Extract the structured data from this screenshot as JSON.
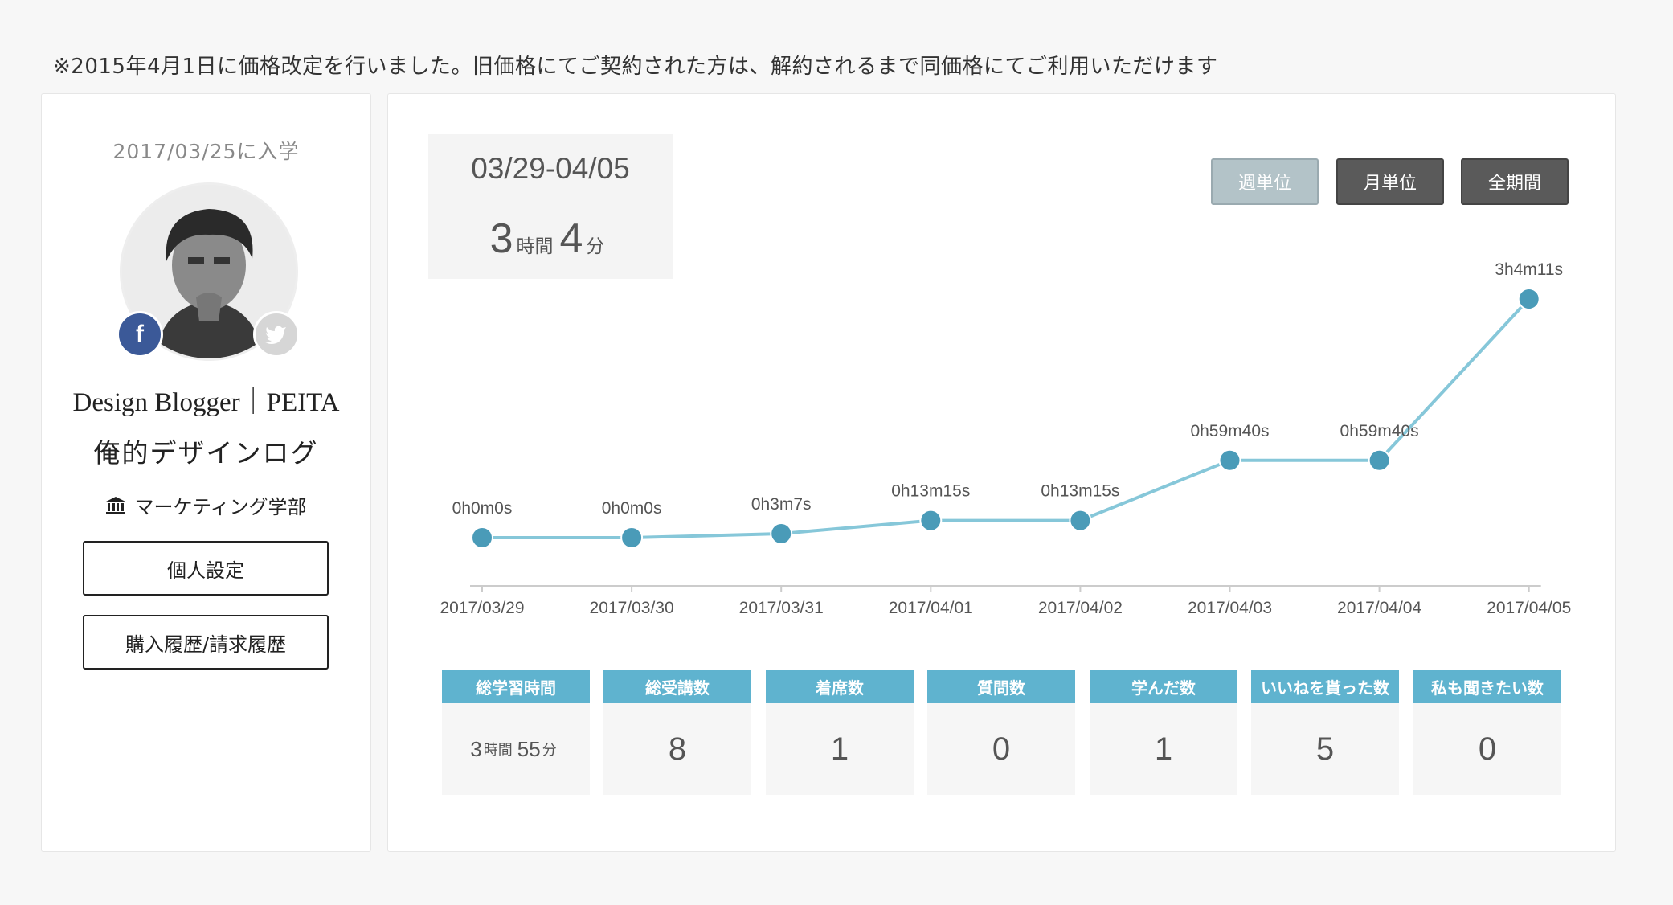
{
  "notice": "※2015年4月1日に価格改定を行いました。旧価格にてご契約された方は、解約されるまで同価格にてご利用いただけます",
  "profile": {
    "enroll_date": "2017/03/25に入学",
    "name": "Design Blogger｜PEITA",
    "blog": "俺的デザインログ",
    "faculty": "マーケティング学部",
    "buttons": {
      "settings": "個人設定",
      "history": "購入履歴/請求履歴"
    }
  },
  "summary": {
    "range": "03/29-04/05",
    "hours": "3",
    "hours_unit": "時間",
    "minutes": "4",
    "minutes_unit": "分"
  },
  "period_tabs": {
    "week": "週単位",
    "month": "月単位",
    "all": "全期間"
  },
  "chart_data": {
    "type": "line",
    "x": [
      "2017/03/29",
      "2017/03/30",
      "2017/03/31",
      "2017/04/01",
      "2017/04/02",
      "2017/04/03",
      "2017/04/04",
      "2017/04/05"
    ],
    "labels": [
      "0h0m0s",
      "0h0m0s",
      "0h3m7s",
      "0h13m15s",
      "0h13m15s",
      "0h59m40s",
      "0h59m40s",
      "3h4m11s"
    ],
    "values": [
      0,
      0,
      187,
      795,
      795,
      3580,
      3580,
      11051
    ],
    "ylim": [
      0,
      11051
    ],
    "grid": false,
    "color": "#86c7d9",
    "point_color": "#4a9bb8"
  },
  "stats": [
    {
      "label": "総学習時間",
      "hours": "3",
      "hours_unit": "時間",
      "minutes": "55",
      "minutes_unit": "分"
    },
    {
      "label": "総受講数",
      "value": "8"
    },
    {
      "label": "着席数",
      "value": "1"
    },
    {
      "label": "質問数",
      "value": "0"
    },
    {
      "label": "学んだ数",
      "value": "1"
    },
    {
      "label": "いいねを貰った数",
      "value": "5"
    },
    {
      "label": "私も聞きたい数",
      "value": "0"
    }
  ]
}
